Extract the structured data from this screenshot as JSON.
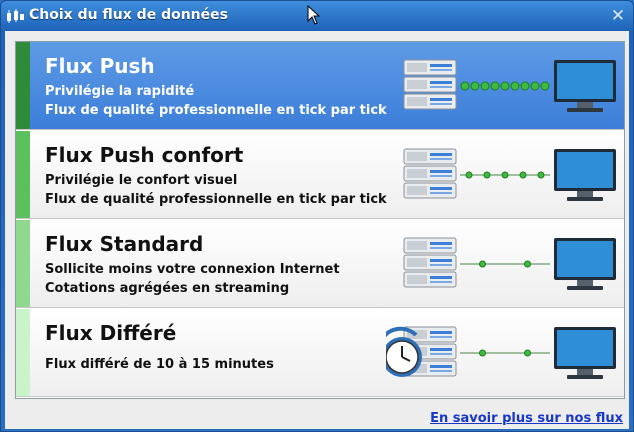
{
  "window": {
    "title": "Choix du flux de données",
    "close_symbol": "✕"
  },
  "options": [
    {
      "title": "Flux Push",
      "line1": "Privilégie la rapidité",
      "line2": "Flux de qualité professionnelle en tick par tick",
      "selected": true,
      "bar_color": "#2e8b3a",
      "connection_icon": "dense-dots-connection-icon"
    },
    {
      "title": "Flux Push confort",
      "line1": "Privilégie le confort visuel",
      "line2": "Flux de qualité professionnelle en tick par tick",
      "selected": false,
      "bar_color": "#5cc15c",
      "connection_icon": "medium-dots-connection-icon"
    },
    {
      "title": "Flux Standard",
      "line1": "Sollicite moins votre connexion Internet",
      "line2": "Cotations agrégées en streaming",
      "selected": false,
      "bar_color": "#8fd98f",
      "connection_icon": "sparse-dots-connection-icon"
    },
    {
      "title": "Flux Différé",
      "line1": "Flux différé de 10 à 15 minutes",
      "line2": "",
      "selected": false,
      "bar_color": "#c9f3c9",
      "connection_icon": "delayed-clock-icon"
    }
  ],
  "footer": {
    "link_text": "En savoir plus sur nos flux"
  },
  "colors": {
    "selected_bg": "#4a8ae0",
    "link": "#1737c9",
    "dot_green": "#3dbb3d"
  }
}
